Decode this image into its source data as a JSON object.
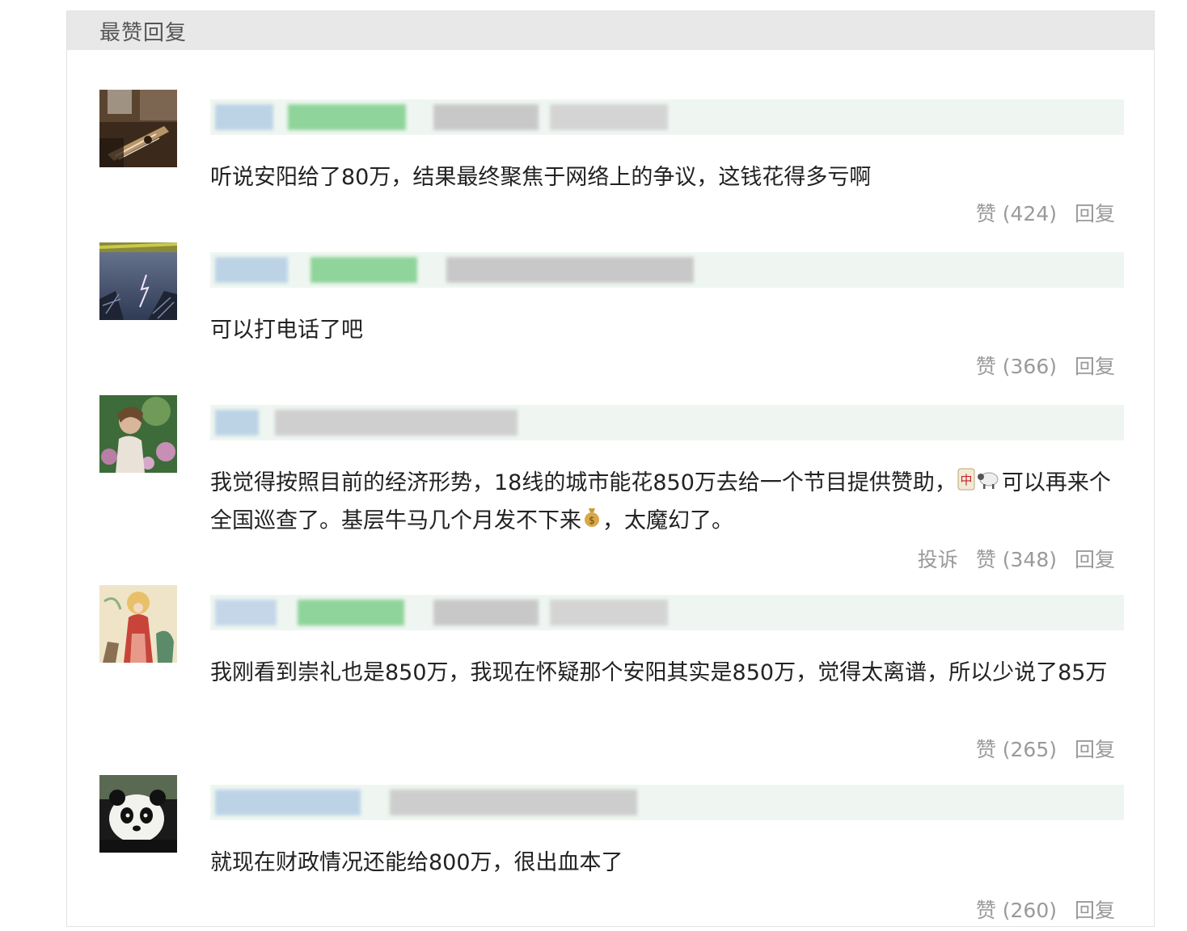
{
  "header": {
    "title": "最赞回复"
  },
  "comments": [
    {
      "text": "听说安阳给了80万，结果最终聚焦于网络上的争议，这钱花得多亏啊",
      "like_label": "赞 (424)",
      "reply_label": "回复",
      "avatar_icon": "guitar-photo-avatar"
    },
    {
      "text": "可以打电话了吧",
      "like_label": "赞 (366)",
      "reply_label": "回复",
      "avatar_icon": "lightning-sky-avatar"
    },
    {
      "text_part1": "我觉得按照目前的经济形势，18线的城市能花850万去给一个节目提供赞助，",
      "text_part2": "可以再来个全国巡查了。基层牛马几个月发不下来",
      "text_part3": "，太魔幻了。",
      "report_label": "投诉",
      "like_label": "赞 (348)",
      "reply_label": "回复",
      "avatar_icon": "woman-flowers-avatar",
      "emojis": [
        "mahjong-red-dragon-icon",
        "sheep-icon",
        "money-bag-icon"
      ]
    },
    {
      "text": "我刚看到崇礼也是850万，我现在怀疑那个安阳其实是850万，觉得太离谱，所以少说了85万",
      "like_label": "赞 (265)",
      "reply_label": "回复",
      "avatar_icon": "traditional-painting-avatar"
    },
    {
      "text": "就现在财政情况还能给800万，很出血本了",
      "like_label": "赞 (260)",
      "reply_label": "回复",
      "avatar_icon": "panda-avatar"
    }
  ],
  "colors": {
    "header_bg": "#e8e8e8",
    "user_bar_bg": "#eff6f1",
    "text": "#222222",
    "muted": "#9a9a9a"
  }
}
